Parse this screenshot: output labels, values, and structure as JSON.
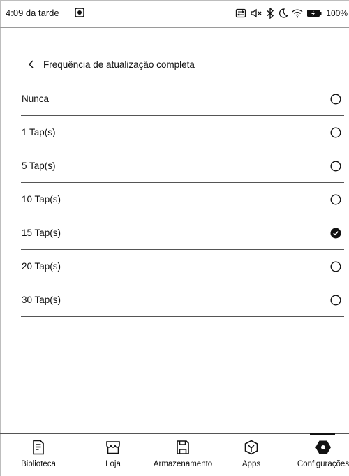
{
  "status_bar": {
    "time": "4:09 da tarde",
    "battery_percent": "100%",
    "icons": [
      "app-notification-icon",
      "screen-rotation-icon",
      "sound-off-icon",
      "bluetooth-icon",
      "night-mode-icon",
      "wifi-icon",
      "battery-charging-icon"
    ]
  },
  "header": {
    "title": "Frequência de atualização completa",
    "back_icon": "chevron-left-icon"
  },
  "options": [
    {
      "label": "Nunca",
      "selected": false
    },
    {
      "label": "1 Tap(s)",
      "selected": false
    },
    {
      "label": "5 Tap(s)",
      "selected": false
    },
    {
      "label": "10 Tap(s)",
      "selected": false
    },
    {
      "label": "15 Tap(s)",
      "selected": true
    },
    {
      "label": "20 Tap(s)",
      "selected": false
    },
    {
      "label": "30 Tap(s)",
      "selected": false
    }
  ],
  "bottom_nav": [
    {
      "label": "Biblioteca",
      "icon": "library-icon",
      "active": false
    },
    {
      "label": "Loja",
      "icon": "store-icon",
      "active": false
    },
    {
      "label": "Armazenamento",
      "icon": "storage-icon",
      "active": false
    },
    {
      "label": "Apps",
      "icon": "apps-icon",
      "active": false
    },
    {
      "label": "Configurações",
      "icon": "settings-icon",
      "active": true
    }
  ],
  "colors": {
    "text": "#111111",
    "divider": "#555555",
    "background": "#ffffff"
  }
}
